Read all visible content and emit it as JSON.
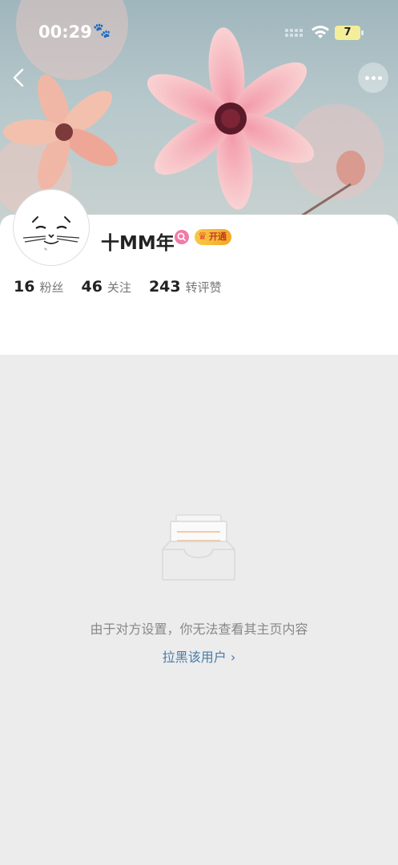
{
  "status_bar": {
    "time": "00:29",
    "battery": "7"
  },
  "cover": {
    "description_icon": "flower-cover-image"
  },
  "header": {
    "back_icon": "chevron-left-icon",
    "more_icon": "more-dots-icon"
  },
  "profile": {
    "name": "十MM年",
    "vip_label": "开通",
    "stats": [
      {
        "value": "16",
        "label": "粉丝"
      },
      {
        "value": "46",
        "label": "关注"
      },
      {
        "value": "243",
        "label": "转评赞"
      }
    ]
  },
  "empty_state": {
    "message": "由于对方设置，你无法查看其主页内容",
    "block_link": "拉黑该用户 ›"
  },
  "colors": {
    "accent_link": "#4a7aa8",
    "vip_gold": "#f6a623",
    "search_pink": "#f07aa8"
  }
}
